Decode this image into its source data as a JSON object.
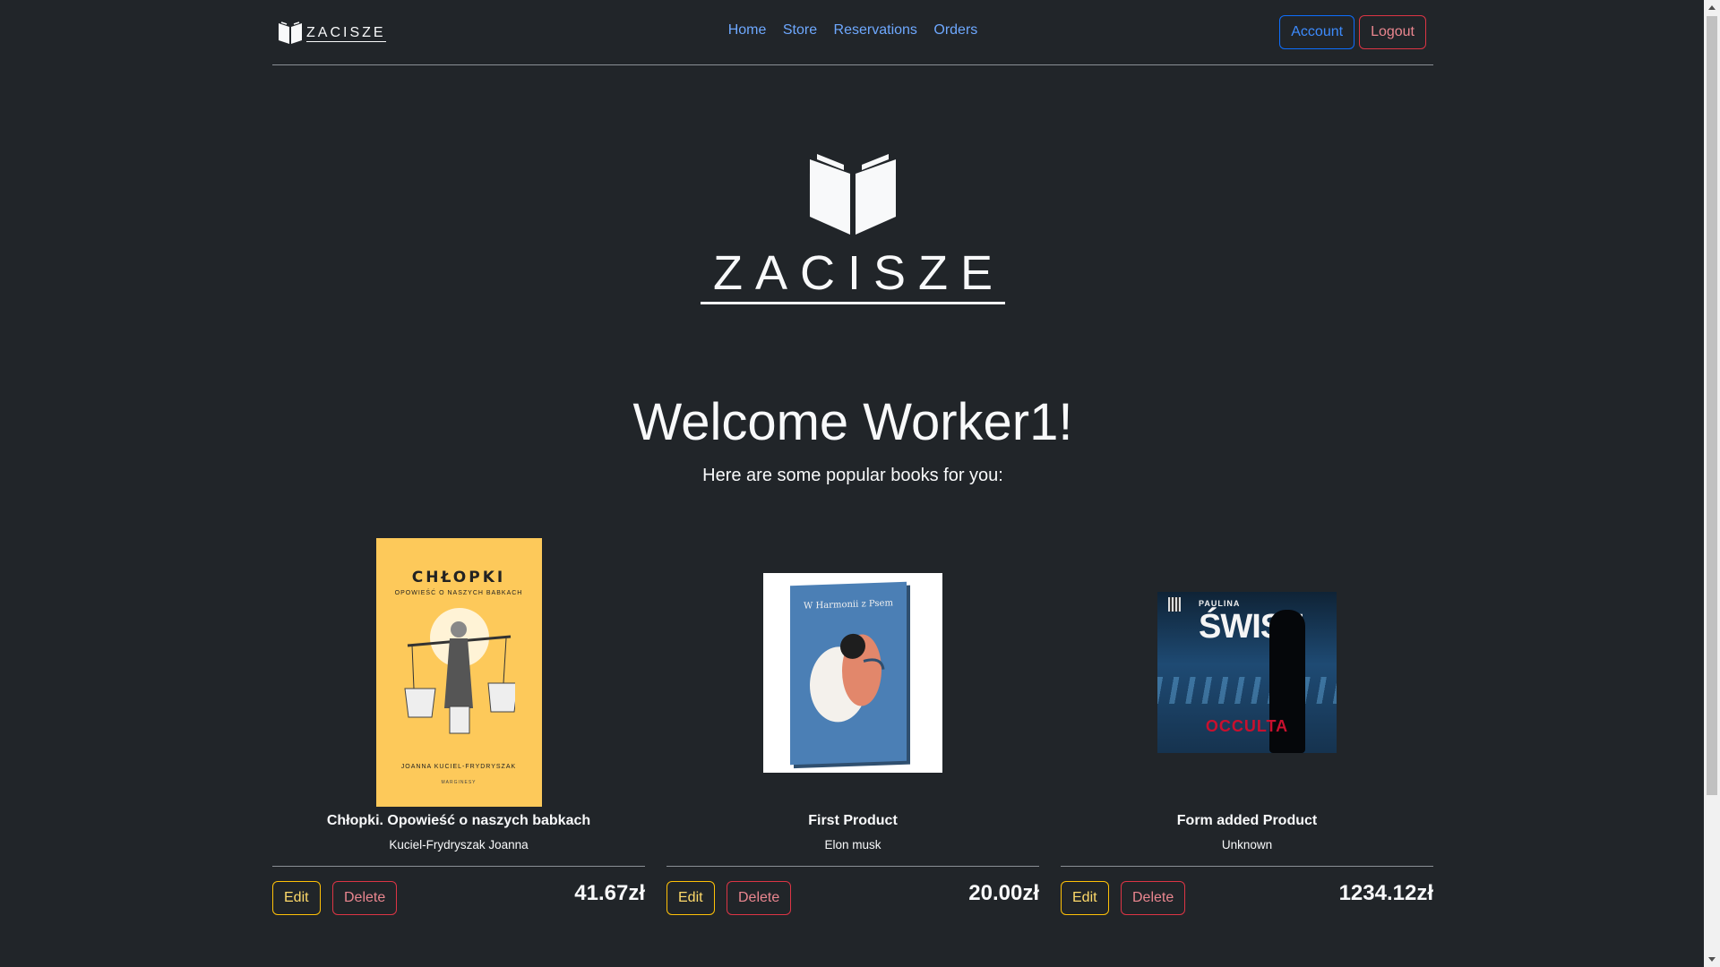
{
  "navbar": {
    "brand": "ZACISZE",
    "links": [
      "Home",
      "Store",
      "Reservations",
      "Orders"
    ],
    "account_label": "Account",
    "logout_label": "Logout"
  },
  "hero": {
    "logo_text": "ZACISZE",
    "welcome": "Welcome Worker1!",
    "subtitle": "Here are some popular books for you:"
  },
  "products": [
    {
      "title": "Chłopki. Opowieść o naszych babkach",
      "author": "Kuciel-Frydryszak Joanna",
      "price": "41.67zł",
      "edit_label": "Edit",
      "delete_label": "Delete",
      "cover": {
        "title": "CHŁOPKI",
        "subtitle": "OPOWIEŚĆ O NASZYCH BABKACH",
        "author": "JOANNA KUCIEL-FRYDRYSZAK",
        "publisher": "MARGINESY"
      }
    },
    {
      "title": "First Product",
      "author": "Elon musk",
      "price": "20.00zł",
      "edit_label": "Edit",
      "delete_label": "Delete",
      "cover": {
        "title": "W Harmonii z Psem"
      }
    },
    {
      "title": "Form added Product",
      "author": "Unknown",
      "price": "1234.12zł",
      "edit_label": "Edit",
      "delete_label": "Delete",
      "cover": {
        "author": "PAULINA",
        "title": "ŚWIST",
        "subtitle": "OCCULTA"
      }
    }
  ],
  "colors": {
    "background": "#212529",
    "link": "#6ea8fe",
    "primary": "#0d6efd",
    "danger": "#dc3545",
    "warning": "#ffc107"
  }
}
